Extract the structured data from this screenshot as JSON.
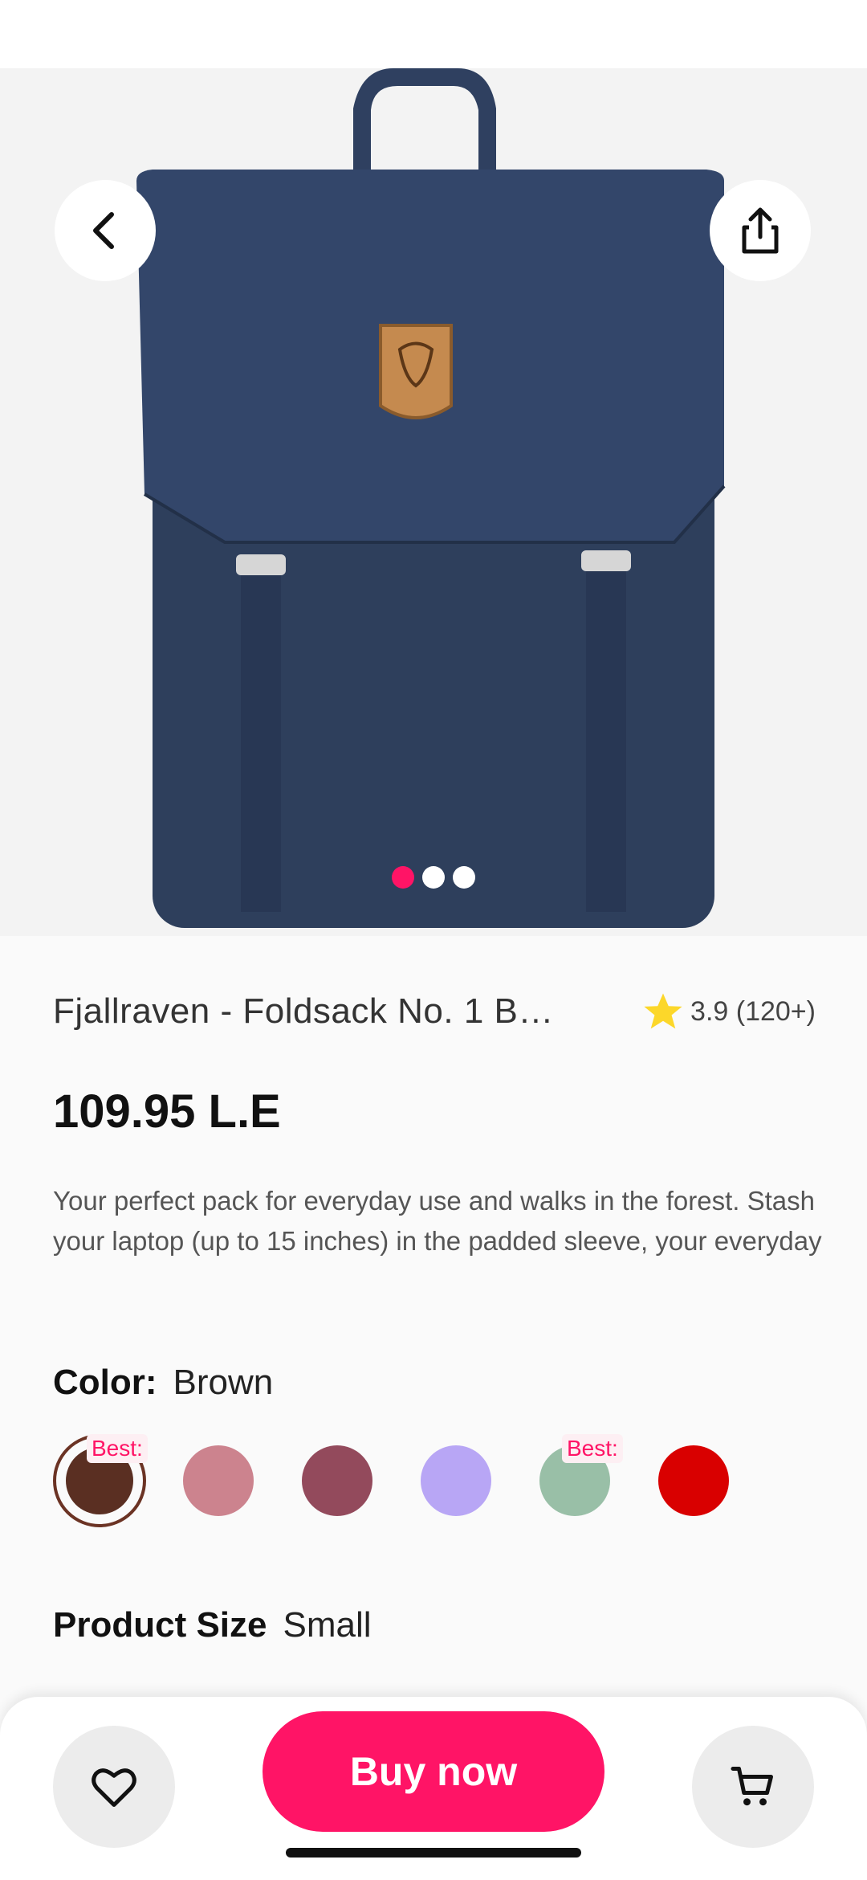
{
  "hero": {
    "image_alt": "Navy Foldsack No. 1 backpack",
    "carousel_pages": 3,
    "carousel_active": 1,
    "back_icon": "chevron-left-icon",
    "share_icon": "share-icon"
  },
  "product": {
    "title": "Fjallraven - Foldsack No. 1 B…",
    "rating": "3.9 (120+)",
    "price": "109.95 L.E",
    "description": "Your perfect pack for everyday use and walks in the forest. Stash your laptop (up to 15 inches) in the padded sleeve, your everyday"
  },
  "color": {
    "label": "Color:",
    "selected": "Brown",
    "swatches": [
      {
        "name": "Brown",
        "hex": "#5a2f22",
        "badge": "Best:",
        "selected": true
      },
      {
        "name": "Rose",
        "hex": "#cc838e",
        "badge": "",
        "selected": false
      },
      {
        "name": "Wine",
        "hex": "#934a5c",
        "badge": "",
        "selected": false
      },
      {
        "name": "Lavender",
        "hex": "#b8a6f5",
        "badge": "",
        "selected": false
      },
      {
        "name": "Sage",
        "hex": "#99bfa7",
        "badge": "Best:",
        "selected": false
      },
      {
        "name": "Red",
        "hex": "#d90000",
        "badge": "",
        "selected": false
      }
    ]
  },
  "size": {
    "label": "Product Size",
    "value": "Small"
  },
  "actions": {
    "buy_label": "Buy now",
    "favorite_icon": "heart-icon",
    "cart_icon": "cart-icon"
  },
  "colors": {
    "accent": "#ff1466",
    "bag": "#2e3f5c"
  }
}
